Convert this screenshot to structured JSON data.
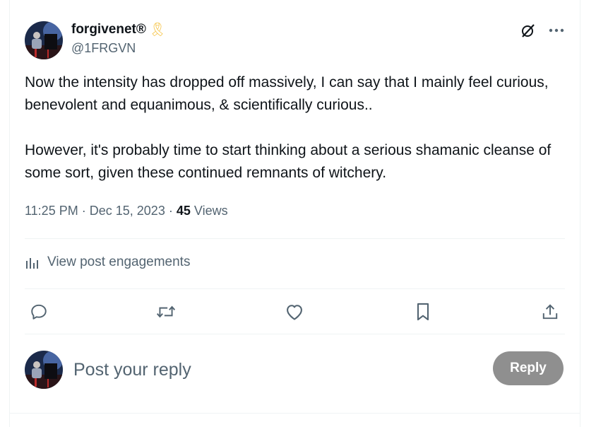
{
  "author": {
    "display_name": "forgivenet®",
    "badge_emoji": "🎗",
    "handle": "@1FRGVN",
    "avatar_icon": "pianist-avatar"
  },
  "tweet": {
    "paragraphs": [
      "Now the intensity has dropped off massively, I can say that I mainly feel curious, benevolent and equanimous, & scientifically curious..",
      "However, it's probably time to start thinking about a serious shamanic cleanse of some sort, given these continued remnants of witchery."
    ],
    "time": "11:25 PM",
    "date": "Dec 15, 2023",
    "separator": "·",
    "views_count": "45",
    "views_label": "Views"
  },
  "engagements": {
    "label": "View post engagements"
  },
  "actions": [
    "reply-icon",
    "repost-icon",
    "like-icon",
    "bookmark-icon",
    "share-icon"
  ],
  "reply_box": {
    "placeholder": "Post your reply",
    "button_label": "Reply"
  },
  "colors": {
    "text": "#0f1419",
    "secondary": "#536471",
    "divider": "#eff3f4",
    "reply_button_disabled": "#8f8f8f",
    "ribbon": "#f5c242"
  }
}
